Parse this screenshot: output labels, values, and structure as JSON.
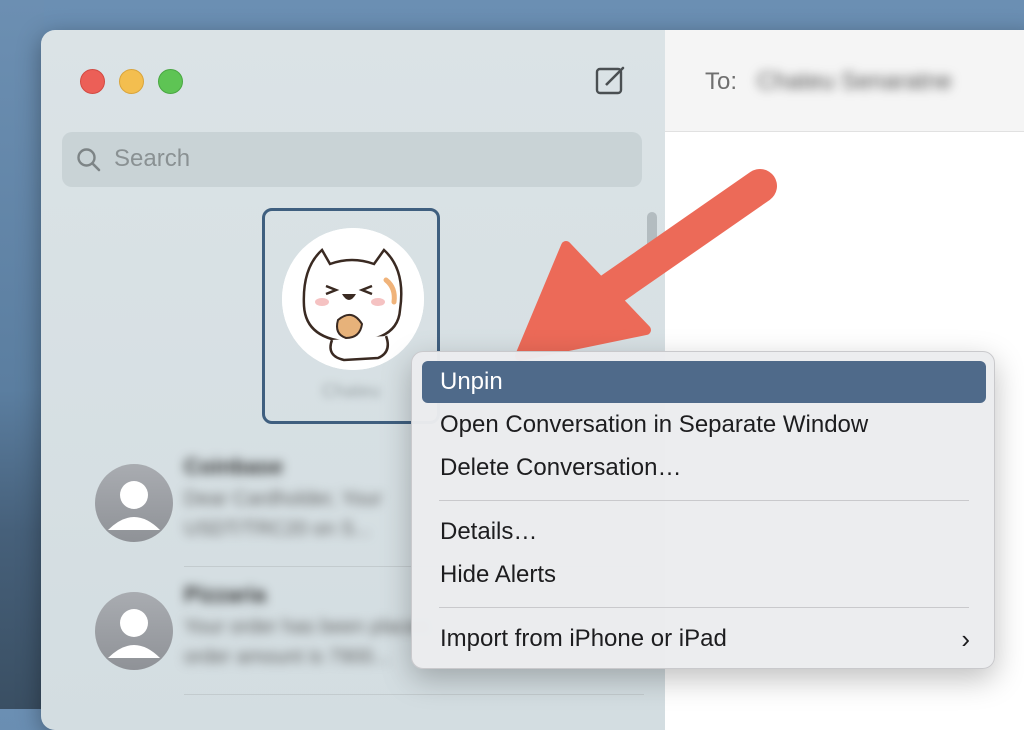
{
  "window": {
    "sidebar": {
      "search": {
        "placeholder": "Search"
      },
      "pinned": {
        "name": "Chateu"
      },
      "conversations": [
        {
          "name": "Coinbase",
          "preview": "Dear Cardholder, Your USDT/TRC20 on S..."
        },
        {
          "name": "Pizzaria",
          "preview": "Your order has been placed, order amount is 7900..."
        }
      ]
    },
    "main": {
      "to_label": "To:",
      "to_value": "Chateu Senaratne"
    }
  },
  "context_menu": {
    "items": [
      {
        "label": "Unpin",
        "highlighted": true
      },
      {
        "label": "Open Conversation in Separate Window"
      },
      {
        "label": "Delete Conversation…"
      },
      {
        "label": "Details…"
      },
      {
        "label": "Hide Alerts"
      },
      {
        "label": "Import from iPhone or iPad",
        "submenu": true
      }
    ]
  },
  "colors": {
    "highlight": "#4f6a8a",
    "arrow": "#ec6a58"
  }
}
